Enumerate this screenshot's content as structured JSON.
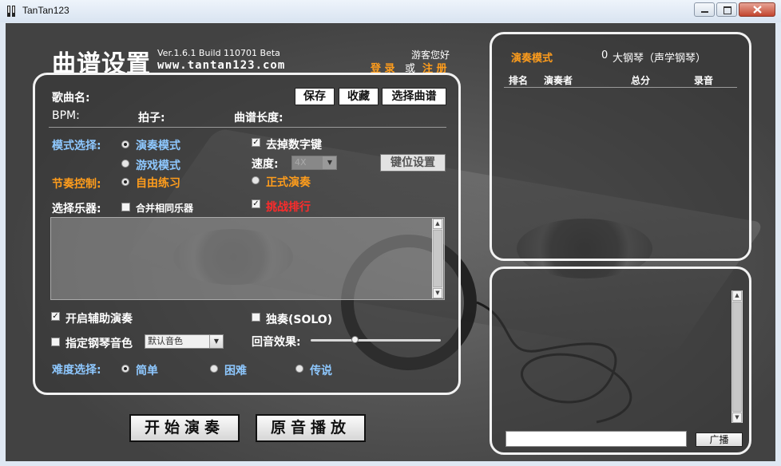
{
  "window": {
    "title": "TanTan123"
  },
  "header": {
    "app_title": "曲谱设置",
    "version": "Ver.1.6.1 Build 110701 Beta",
    "website": "www.tantan123.com",
    "guest_greeting": "游客您好",
    "login": "登 录",
    "or": "或",
    "register": "注 册"
  },
  "song": {
    "name_label": "歌曲名:",
    "bpm_label": "BPM:",
    "beat_label": "拍子:",
    "length_label": "曲谱长度:",
    "save_btn": "保存",
    "fav_btn": "收藏",
    "select_btn": "选择曲谱"
  },
  "options": {
    "mode_label": "模式选择:",
    "mode_play": "演奏模式",
    "mode_game": "游戏模式",
    "rhythm_label": "节奏控制:",
    "rhythm_free": "自由练习",
    "rhythm_formal": "正式演奏",
    "remove_digit_keys": "去掉数字键",
    "speed_label": "速度:",
    "speed_value": "4X",
    "key_settings_btn": "键位设置",
    "challenge_rank": "挑战排行",
    "instrument_label": "选择乐器:",
    "merge_instruments": "合并相同乐器",
    "assist_play": "开启辅助演奏",
    "solo": "独奏(SOLO)",
    "piano_tone_label": "指定钢琴音色",
    "piano_tone_value": "默认音色",
    "echo_label": "回音效果:",
    "difficulty_label": "难度选择:",
    "diff_easy": "简单",
    "diff_hard": "困难",
    "diff_legend": "传说"
  },
  "actions": {
    "start_btn": "开始演奏",
    "original_btn": "原音播放"
  },
  "ranking": {
    "mode": "演奏模式",
    "count": "0",
    "instrument": "大钢琴（声学钢琴）",
    "col_rank": "排名",
    "col_player": "演奏者",
    "col_score": "总分",
    "col_record": "录音"
  },
  "chat": {
    "broadcast_btn": "广播",
    "input_value": ""
  },
  "colors": {
    "accent_orange": "#ff9d1c",
    "accent_blue": "#8ec8ff",
    "challenge_red": "#ff2b2b"
  }
}
